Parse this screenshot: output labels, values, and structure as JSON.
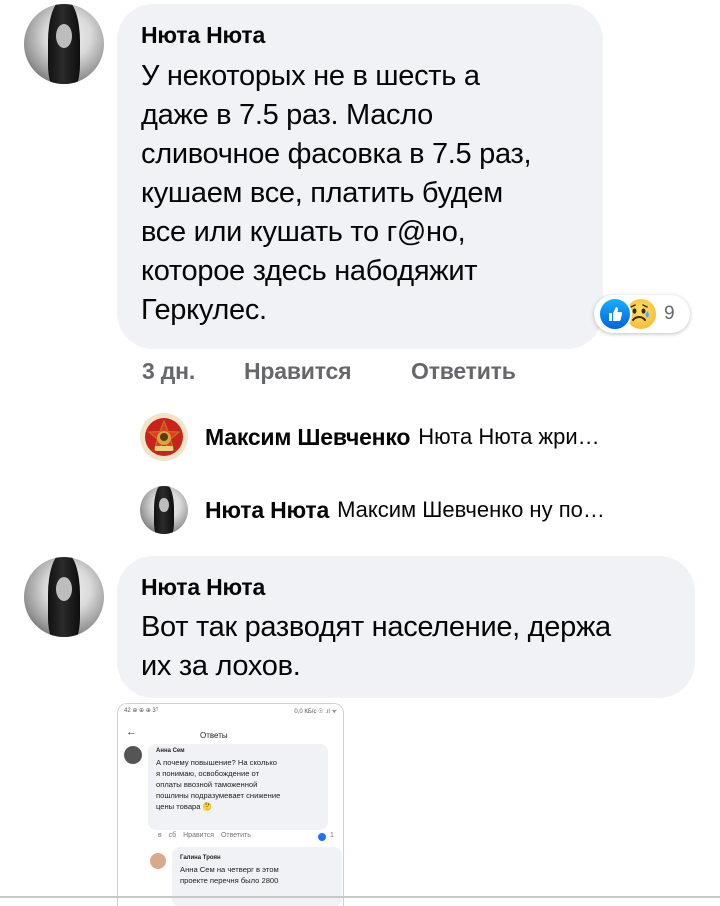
{
  "comment1": {
    "author": "Нюта Нюта",
    "lines": [
      "У некоторых не в шесть а",
      "даже в 7.5 раз. Масло",
      "сливочное фасовка в 7.5 раз,",
      "кушаем все, платить будем",
      "все или кушать то г@но,",
      "которое здесь набодяжит",
      "Геркулес."
    ],
    "reactions": {
      "icons": [
        "like-icon",
        "sad-icon"
      ],
      "count": "9"
    },
    "time": "3 дн.",
    "like_label": "Нравится",
    "reply_label": "Ответить"
  },
  "replies": [
    {
      "author": "Максим Шевченко",
      "preview": "Нюта Нюта жри…"
    },
    {
      "author": "Нюта Нюта",
      "preview": "Максим Шевченко ну по…"
    }
  ],
  "comment2": {
    "author": "Нюта Нюта",
    "lines": [
      "Вот так разводят население, держа",
      "их за лохов."
    ]
  },
  "attachment": {
    "status_left": "42 ⊕ ⊕ ⊕ 3ᵀ",
    "status_right": "0,0 КБ/с ☉ .ıl ᯤ",
    "title": "Ответы",
    "comment_author": "Анна Сем",
    "comment_lines": [
      "А почему повышение? На сколько",
      "я понимаю, освобождение от",
      "оплаты ввозной таможенной",
      "пошлины подразумевает снижение",
      "цены товара 🤔"
    ],
    "meta": "в сб Нравится Ответить",
    "like_count": "1",
    "reply_author": "Галина Троян",
    "reply_lines": [
      "Анна Сем на четверг в этом",
      "проекте перечня было 2800"
    ]
  },
  "colors": {
    "bubble": "#f0f2f5",
    "meta_text": "#65676b",
    "like_blue": "#1877f2"
  }
}
